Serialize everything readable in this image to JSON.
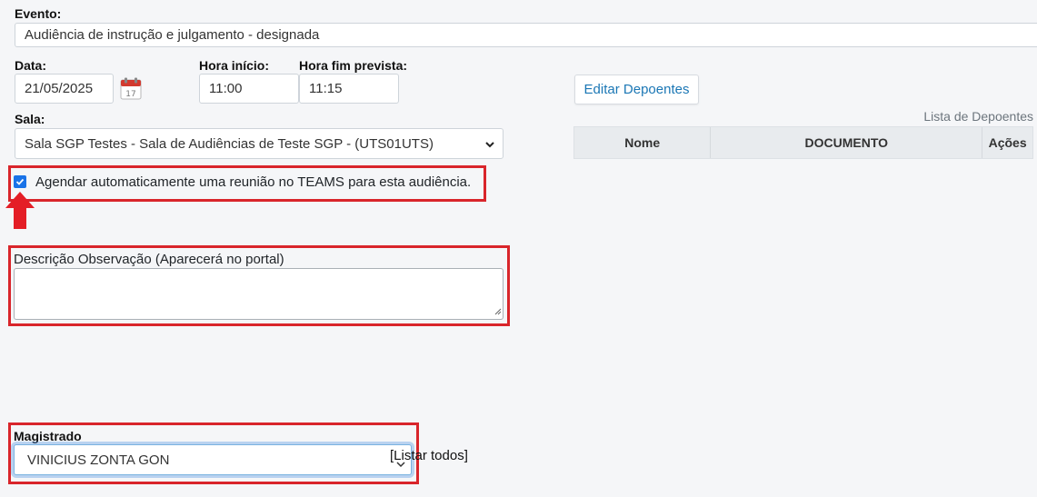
{
  "evento": {
    "label": "Evento:",
    "value": "Audiência de instrução e julgamento - designada"
  },
  "data": {
    "label": "Data:",
    "value": "21/05/2025"
  },
  "hora_inicio": {
    "label": "Hora início:",
    "value": "11:00"
  },
  "hora_fim": {
    "label": "Hora fim prevista:",
    "value": "11:15"
  },
  "depoentes": {
    "edit_button": "Editar Depoentes",
    "list_caption": "Lista de Depoentes",
    "columns": [
      "Nome",
      "DOCUMENTO",
      "Ações"
    ]
  },
  "sala": {
    "label": "Sala:",
    "selected": "Sala SGP Testes - Sala de Audiências de Teste SGP - (UTS01UTS)"
  },
  "teams": {
    "checked": true,
    "label": "Agendar automaticamente uma reunião no TEAMS para esta audiência."
  },
  "descricao": {
    "label": "Descrição Observação (Aparecerá no portal)",
    "value": ""
  },
  "magistrado": {
    "label": "Magistrado",
    "value": "VINICIUS ZONTA GON",
    "listar_todos": "[Listar todos]"
  },
  "colors": {
    "highlight_red": "#d9252b",
    "accent_blue": "#1b77b5",
    "checkbox_blue": "#1a73e8"
  },
  "icons": {
    "calendar": "calendar-icon",
    "arrow": "arrow-up-icon"
  }
}
